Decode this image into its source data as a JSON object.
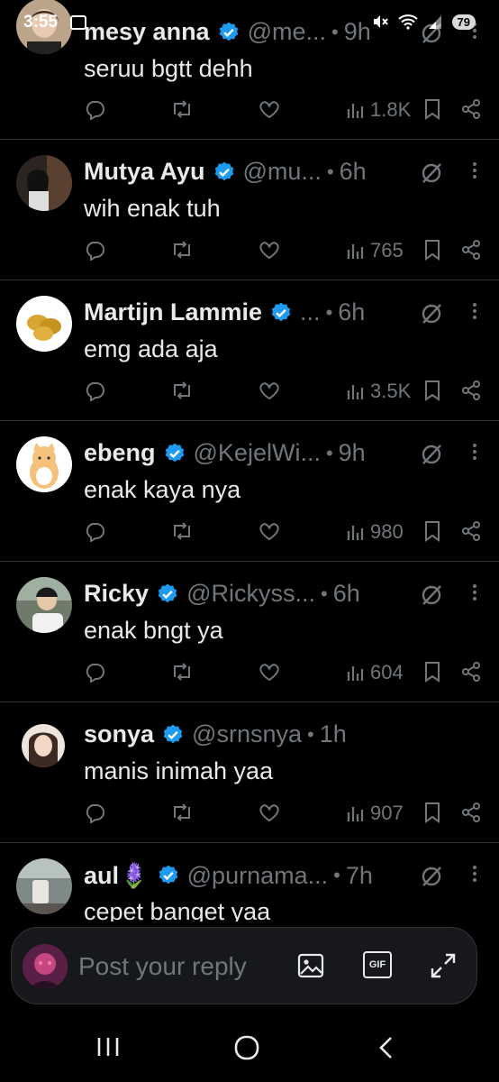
{
  "status_bar": {
    "time": "3:55",
    "battery": "79"
  },
  "tweets": [
    {
      "name": "mesy anna",
      "handle": "@me...",
      "time": "9h",
      "text": "seruu bgtt dehh",
      "views": "1.8K"
    },
    {
      "name": "Mutya Ayu",
      "handle": "@mu...",
      "time": "6h",
      "text": "wih enak tuh",
      "views": "765"
    },
    {
      "name": "Martijn Lammie",
      "handle": "...",
      "time": "6h",
      "text": "emg ada aja",
      "views": "3.5K"
    },
    {
      "name": "ebeng",
      "handle": "@KejelWi...",
      "time": "9h",
      "text": "enak kaya nya",
      "views": "980"
    },
    {
      "name": "Ricky",
      "handle": "@Rickyss...",
      "time": "6h",
      "text": "enak bngt ya",
      "views": "604"
    },
    {
      "name": "sonya",
      "handle": "@srnsnya",
      "time": "1h",
      "text": "manis inimah yaa",
      "views": "907"
    },
    {
      "name": "aul🪻",
      "handle": "@purnama...",
      "time": "7h",
      "text": "cepet banget yaa",
      "views": ""
    }
  ],
  "reply": {
    "placeholder": "Post your reply",
    "gif_label": "GIF"
  },
  "colors": {
    "verified": "#1d9bf0",
    "muted": "#71767b",
    "text": "#e7e9ea",
    "divider": "#2f3336"
  }
}
